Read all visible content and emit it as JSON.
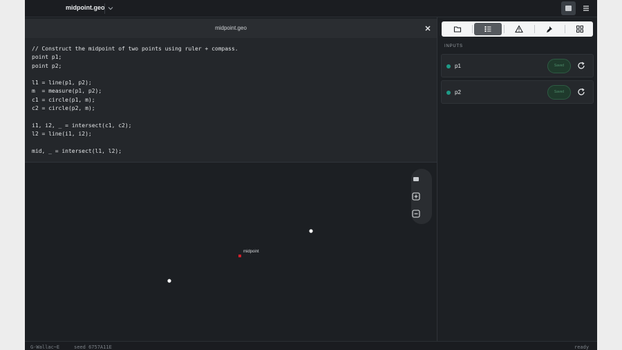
{
  "topbar": {
    "file_title": "midpoint.geo",
    "chevron_icon": "chevron-down-icon",
    "square_button_icon": "preview-icon",
    "menu_icon": "hamburger-menu-icon"
  },
  "editor": {
    "tab_title": "midpoint.geo",
    "close_icon": "close-icon",
    "code_lines": [
      "// Construct the midpoint of two points using ruler + compass.",
      "point p1;",
      "point p2;",
      "",
      "l1 = line(p1, p2);",
      "m  = measure(p1, p2);",
      "c1 = circle(p1, m);",
      "c2 = circle(p2, m);",
      "",
      "i1, i2, _ = intersect(c1, c2);",
      "l2 = line(i1, i2);",
      "",
      "mid, _ = intersect(l1, l2);"
    ]
  },
  "canvas": {
    "midpoint_label": "midpoint",
    "zoom_controls": [
      "fit-icon",
      "zoom-in-icon",
      "zoom-out-icon"
    ],
    "colors": {
      "point": "#ffffff",
      "midpoint": "#d0202a",
      "background": "#1c1f23"
    }
  },
  "sidebar": {
    "toolbar_icons": [
      "folder-icon",
      "list-icon",
      "warning-icon",
      "pin-icon",
      "grid-icon"
    ],
    "active_tool": "list-icon",
    "section_label": "INPUTS",
    "inputs": [
      {
        "name": "p1",
        "status": "Saved"
      },
      {
        "name": "p2",
        "status": "Saved"
      }
    ],
    "accent_color": "#1e9b87"
  },
  "statusbar": {
    "left": "G-Wallac~E",
    "seed": "seed 6757A11E",
    "right": "ready"
  }
}
